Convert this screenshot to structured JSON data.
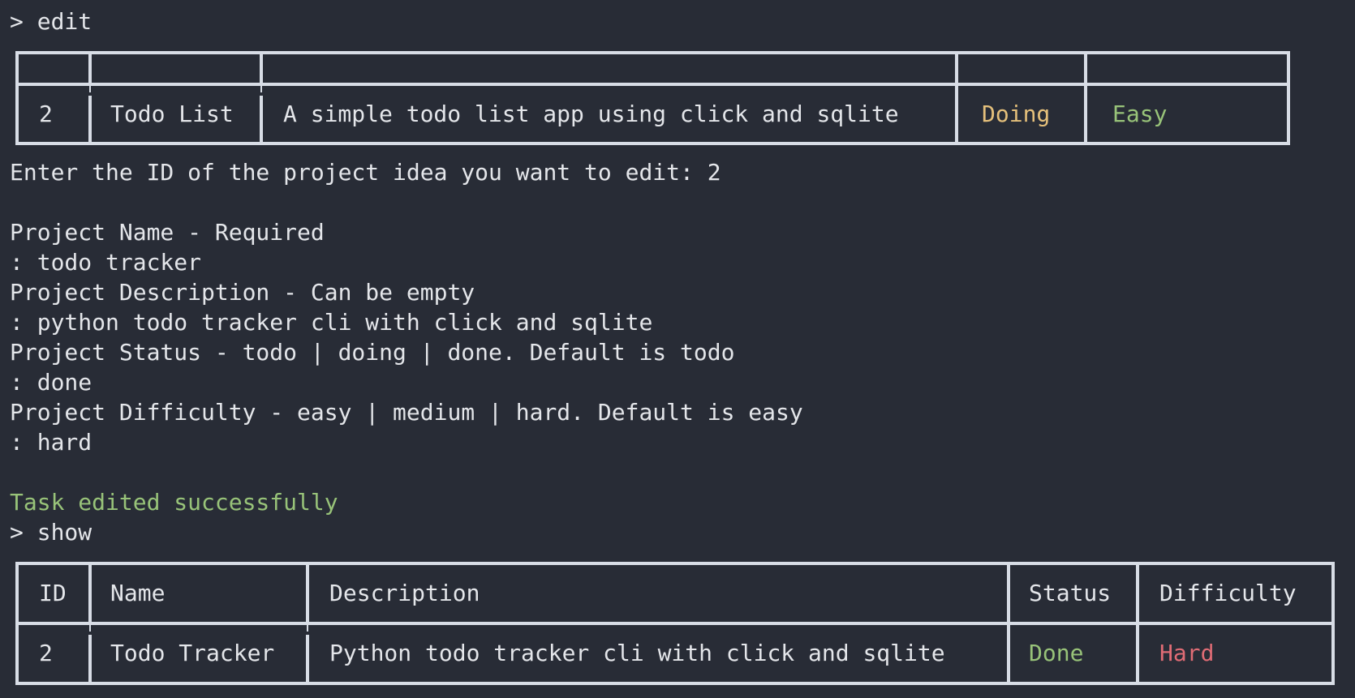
{
  "terminal": {
    "cmd_edit": "> edit",
    "prompt_id": "Enter the ID of the project idea you want to edit: 2",
    "name_label": "Project Name - Required",
    "name_value": ": todo tracker",
    "desc_label": "Project Description - Can be empty",
    "desc_value": ": python todo tracker cli with click and sqlite",
    "status_label": "Project Status - todo | doing | done. Default is todo",
    "status_value": ": done",
    "difficulty_label": "Project Difficulty - easy | medium | hard. Default is easy",
    "difficulty_value": ": hard",
    "success_message": "Task edited successfully",
    "cmd_show": "> show"
  },
  "table_before": {
    "headers": [
      "",
      "",
      "",
      "",
      ""
    ],
    "row": {
      "id": "2",
      "name": "Todo List",
      "description": "A simple todo list app using click and sqlite",
      "status": "Doing",
      "difficulty": "Easy"
    }
  },
  "table_after": {
    "headers": [
      "ID",
      "Name",
      "Description",
      "Status",
      "Difficulty"
    ],
    "row": {
      "id": "2",
      "name": "Todo Tracker",
      "description": "Python todo tracker cli with click and sqlite",
      "status": "Done",
      "difficulty": "Hard"
    }
  },
  "colors": {
    "background": "#282c36",
    "text": "#e4e6ea",
    "border": "#d8dde6",
    "success_green": "#98c379",
    "doing_yellow": "#e5c07b",
    "hard_red": "#e06c75",
    "easy_green": "#98c379",
    "done_green": "#98c379"
  }
}
